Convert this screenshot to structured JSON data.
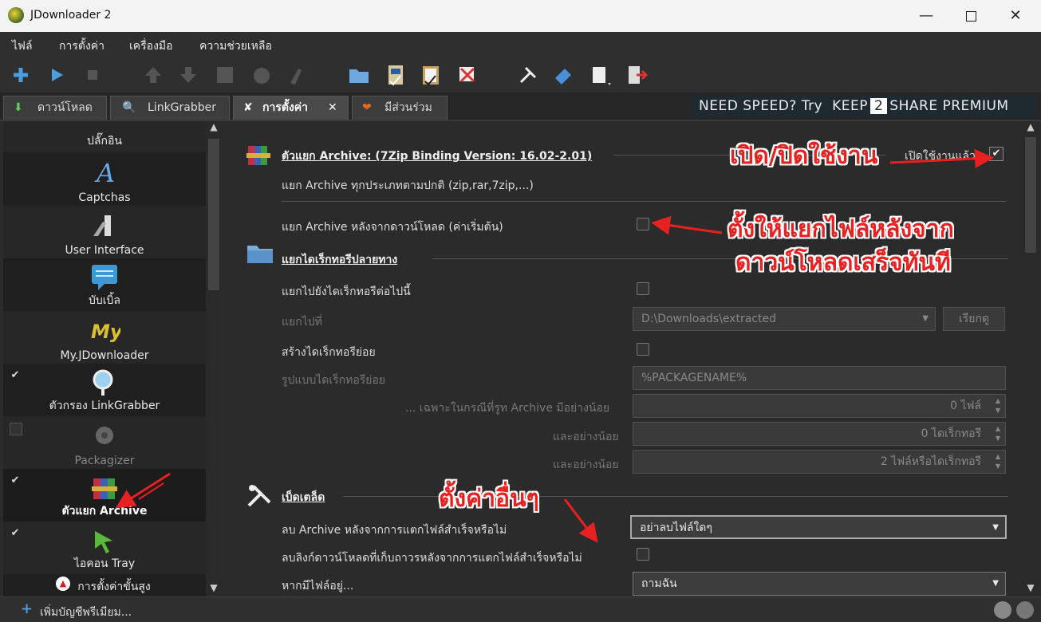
{
  "window": {
    "title": "JDownloader 2"
  },
  "menu": [
    "ไฟล์",
    "การตั้งค่า",
    "เครื่องมือ",
    "ความช่วยเหลือ"
  ],
  "tabs": [
    {
      "label": "ดาวน์โหลด"
    },
    {
      "label": "LinkGrabber"
    },
    {
      "label": "การตั้งค่า"
    },
    {
      "label": "มีส่วนร่วม"
    }
  ],
  "banner": {
    "prefix": "NEED SPEED? Try",
    "brand1": "KEEP",
    "brand2": "2",
    "brand3": "SHARE",
    "suffix": "PREMIUM"
  },
  "sidebar": {
    "items": [
      {
        "label": "ปลั๊กอิน",
        "checked": ""
      },
      {
        "label": "Captchas",
        "checked": ""
      },
      {
        "label": "User Interface",
        "checked": ""
      },
      {
        "label": "บับเบิ้ล",
        "checked": ""
      },
      {
        "label": "My.JDownloader",
        "checked": ""
      },
      {
        "label": "ตัวกรอง LinkGrabber",
        "checked": "✔"
      },
      {
        "label": "Packagizer",
        "checked": ""
      },
      {
        "label": "ตัวแยก Archive",
        "checked": "✔"
      },
      {
        "label": "ไอคอน Tray",
        "checked": "✔"
      },
      {
        "label": "การตั้งค่าขั้นสูง",
        "checked": "✔"
      }
    ]
  },
  "main": {
    "section1": {
      "title": "ตัวแยก Archive: (7Zip Binding Version: 16.02-2.01)",
      "enabled_label": "เปิดใช้งานแล้ว",
      "desc": "แยก Archive ทุกประเภทตามปกติ (zip,rar,7zip,...)",
      "after_download": "แยก Archive หลังจากดาวน์โหลด (ค่าเริ่มต้น)"
    },
    "section2": {
      "title": "แยกไดเร็กทอรีปลายทาง",
      "extract_to_dir": "แยกไปยังไดเร็กทอรีต่อไปนี้",
      "extract_to": "แยกไปที่",
      "path_value": "D:\\Downloads\\extracted",
      "browse": "เรียกดู",
      "create_subdir": "สร้างไดเร็กทอรีย่อย",
      "subdir_pattern": "รูปแบบไดเร็กทอรีย่อย",
      "subdir_value": "%PACKAGENAME%",
      "only_if": "... เฉพาะในกรณีที่รูท Archive มีอย่างน้อย",
      "files_value": "0 ไฟล์",
      "and_min1": "และอย่างน้อย",
      "dirs_value": "0 ไดเร็กทอรี",
      "and_min2": "และอย่างน้อย",
      "both_value": "2 ไฟล์หรือไดเร็กทอรี"
    },
    "section3": {
      "title": "เบ็ดเตล็ด",
      "delete_archive": "ลบ Archive หลังจากการแตกไฟล์สำเร็จหรือไม่",
      "delete_archive_value": "อย่าลบไฟล์ใดๆ",
      "delete_links": "ลบลิงก์ดาวน์โหลดที่เก็บถาวรหลังจากการแตกไฟล์สำเร็จหรือไม่",
      "if_exists": "หากมีไฟล์อยู่...",
      "if_exists_value": "ถามฉัน"
    }
  },
  "annotations": {
    "a1": "เปิด/ปิดใช้งาน",
    "a2_line1": "ตั้งให้แยกไฟล์หลังจาก",
    "a2_line2": "ดาวน์โหลดเสร็จทันที",
    "a3": "ตั้งค่าอื่นๆ"
  },
  "statusbar": {
    "add_account": "เพิ่มบัญชีพรีเมียม..."
  }
}
